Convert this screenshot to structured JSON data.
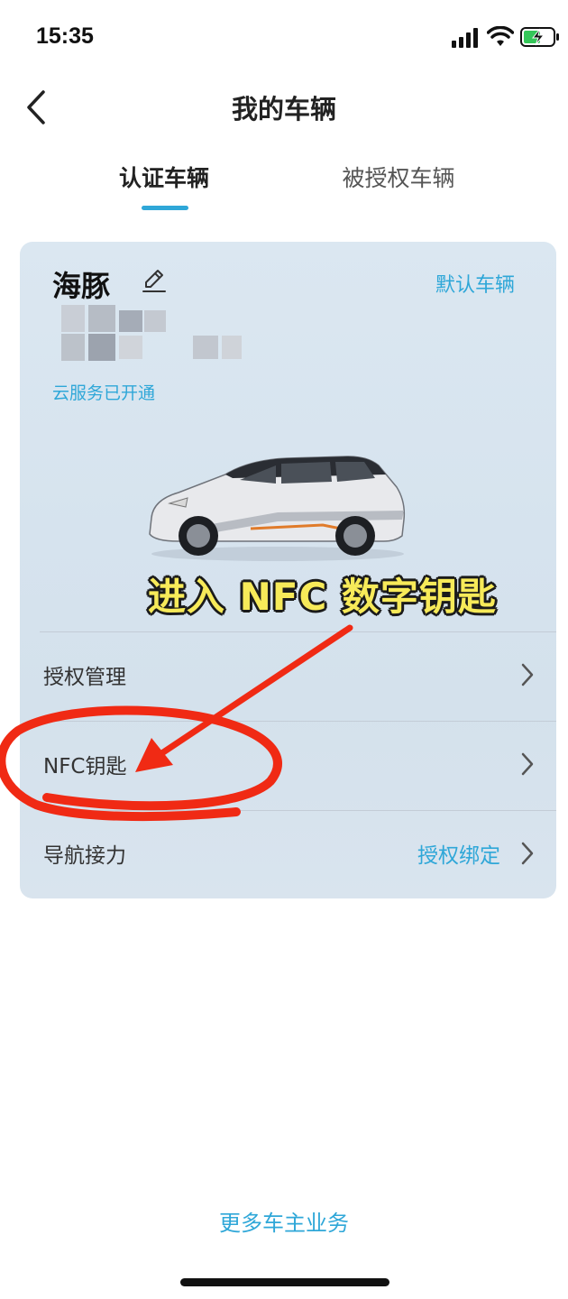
{
  "status_bar": {
    "time": "15:35"
  },
  "header": {
    "title": "我的车辆",
    "back_icon": "chevron-left-icon"
  },
  "tabs": [
    {
      "label": "认证车辆",
      "active": true
    },
    {
      "label": "被授权车辆",
      "active": false
    }
  ],
  "vehicle": {
    "name": "海豚",
    "edit_icon": "pencil-icon",
    "default_label": "默认车辆",
    "cloud_status": "云服务已开通",
    "plate_obscured": true
  },
  "annotation": {
    "text": "进入 NFC 数字钥匙",
    "color": "#f7ea59",
    "arrow_color": "#f02a14"
  },
  "menu": [
    {
      "label": "授权管理",
      "value": ""
    },
    {
      "label": "NFC钥匙",
      "value": ""
    },
    {
      "label": "导航接力",
      "value": "授权绑定"
    }
  ],
  "footer": {
    "more_services": "更多车主业务"
  },
  "colors": {
    "accent": "#2fa7d8",
    "card_bg": "#d6e3ee"
  }
}
